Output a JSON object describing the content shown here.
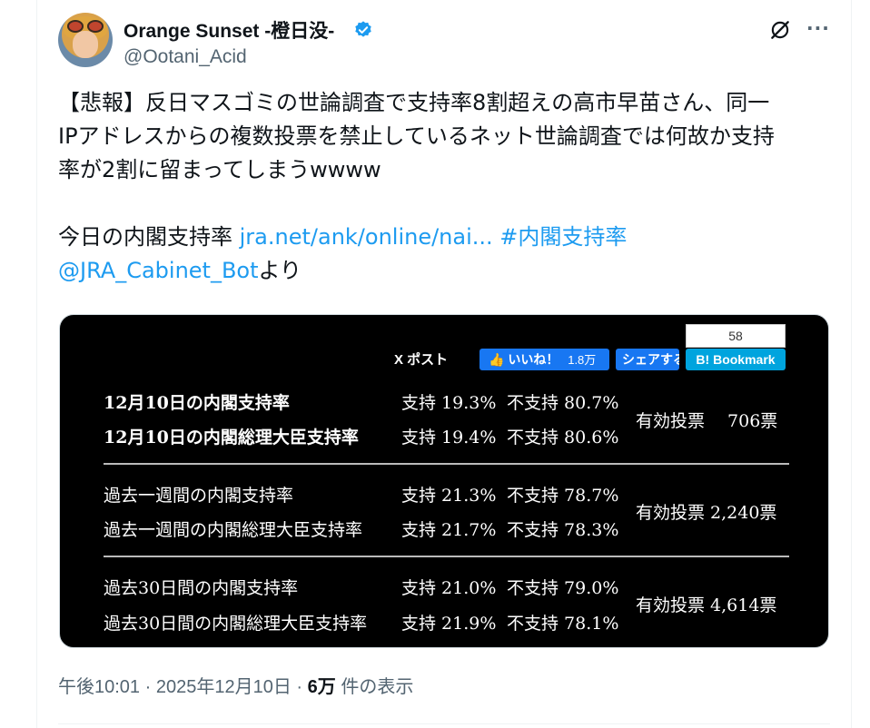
{
  "author": {
    "display_name": "Orange Sunset -橙日没-",
    "handle": "@Ootani_Acid",
    "verified": true,
    "accent_color": "#1d9bf0"
  },
  "header_icons": [
    "grok-icon",
    "more-icon"
  ],
  "tweet": {
    "line1": "【悲報】反日マスゴミの世論調査で支持率8割超えの高市早苗さん、同一",
    "line2": "IPアドレスからの複数投票を禁止しているネット世論調査では何故か支持",
    "line3": "率が2割に留まってしまうwwww",
    "line4_prefix": "今日の内閣支持率 ",
    "link_url": "jra.net/ank/online/nai...",
    "hashtag": "#内閣支持率",
    "mention": "@JRA_Cabinet_Bot",
    "mention_suffix": "より"
  },
  "image_card": {
    "x_post_label": "X ポスト",
    "like_label": "いいね！",
    "like_count": "1.8万",
    "share_label": "シェアする",
    "bookmark_count": "58",
    "bookmark_label": "B! Bookmark",
    "sections": [
      {
        "rows": [
          {
            "label": "12月10日の内閣支持率",
            "support": "支持 19.3%",
            "oppose": "不支持 80.7%"
          },
          {
            "label": "12月10日の内閣総理大臣支持率",
            "support": "支持 19.4%",
            "oppose": "不支持 80.6%"
          }
        ],
        "votes": "有効投票　 706票",
        "bold": true
      },
      {
        "rows": [
          {
            "label": "過去一週間の内閣支持率",
            "support": "支持 21.3%",
            "oppose": "不支持 78.7%"
          },
          {
            "label": "過去一週間の内閣総理大臣支持率",
            "support": "支持 21.7%",
            "oppose": "不支持 78.3%"
          }
        ],
        "votes": "有効投票 2,240票",
        "bold": false
      },
      {
        "rows": [
          {
            "label": "過去30日間の内閣支持率",
            "support": "支持 21.0%",
            "oppose": "不支持 79.0%"
          },
          {
            "label": "過去30日間の内閣総理大臣支持率",
            "support": "支持 21.9%",
            "oppose": "不支持 78.1%"
          }
        ],
        "votes": "有効投票 4,614票",
        "bold": false
      }
    ]
  },
  "meta": {
    "time": "午後10:01",
    "date": "2025年12月10日",
    "views_count": "6万",
    "views_suffix": "件の表示",
    "separator": "·"
  }
}
